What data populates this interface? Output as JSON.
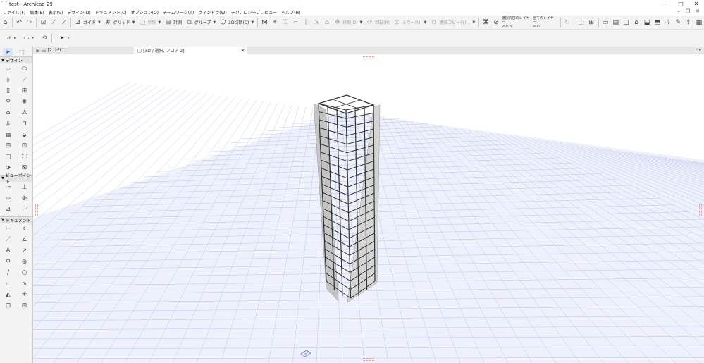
{
  "window": {
    "title": "test - Archicad 29",
    "controls": [
      "—",
      "□",
      "✕"
    ]
  },
  "menubar": {
    "items": [
      "ファイル(F)",
      "編集(E)",
      "表示(V)",
      "デザイン(D)",
      "ドキュメント(C)",
      "オプション(O)",
      "チームワーク(T)",
      "ウィンドウ(W)",
      "テクノロジープレビュー",
      "ヘルプ(H)"
    ]
  },
  "toolbar": {
    "guide_label": "ガイド",
    "grid_label": "グリッド",
    "ref_label": "参照",
    "measure_label": "計測",
    "group_label": "グループ",
    "cut3d_label": "3D切断(C)",
    "move_label": "移動(D)",
    "rotate_label": "回転(R)",
    "mirror_label": "ミラー(M)",
    "multicopy_label": "連続コピー(Y)...",
    "layer_sel_label": "選択内容のレイヤー",
    "layer_all_label": "全てのレイヤー:"
  },
  "tabs": [
    {
      "label": "[2. 2FL]"
    },
    {
      "label": "[3D / 選択, フロア 2]",
      "close": "✕"
    }
  ],
  "toolbox": {
    "sections": {
      "design": "デザイン",
      "viewpoint": "ビューポイント",
      "document": "ドキュメント"
    }
  },
  "colors": {
    "grid_line": "#bfc8ee",
    "column_shade": "#c4c4c4",
    "frame": "#333333",
    "accent": "#3a6fd8"
  }
}
